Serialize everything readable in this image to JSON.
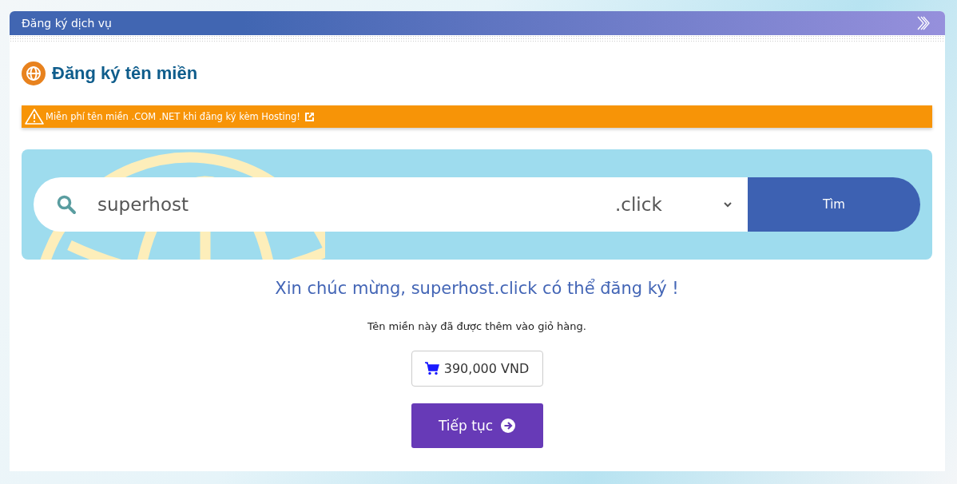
{
  "header": {
    "title": "Đăng ký dịch vụ"
  },
  "heading": "Đăng ký tên miền",
  "alert": {
    "text": "Miễn phí tên miền .COM .NET khi đăng ký kèm Hosting!"
  },
  "search": {
    "value": "superhost",
    "tld": ".click",
    "button": "Tìm"
  },
  "result": {
    "message": "Xin chúc mừng, superhost.click có thể đăng ký !",
    "note": "Tên miền này đã được thêm vào giỏ hàng.",
    "price": "390,000 VND",
    "continue": "Tiếp tục"
  }
}
